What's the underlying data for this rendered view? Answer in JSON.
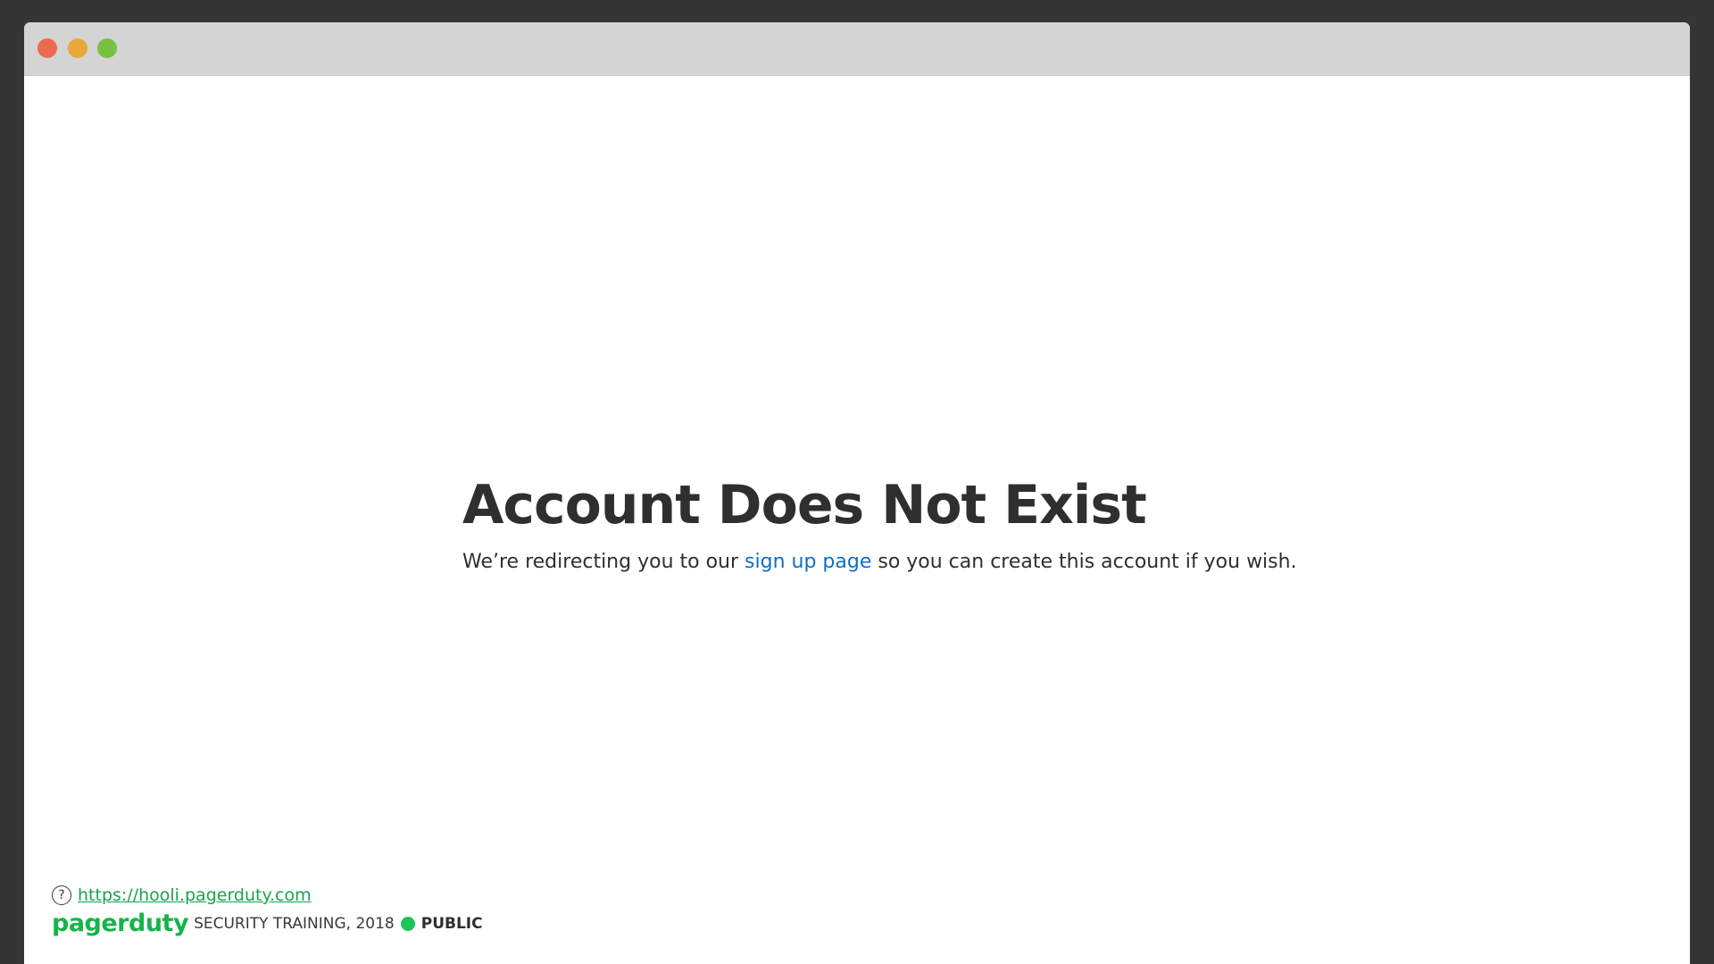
{
  "window": {
    "buttons": [
      "close",
      "minimize",
      "zoom"
    ]
  },
  "main": {
    "title": "Account Does Not Exist",
    "message_before": "We’re redirecting you to our ",
    "link_label": "sign up page",
    "message_after": " so you can create this account if you wish.",
    "link_color": "#0e6fc6"
  },
  "footer": {
    "icon": "help-circle-icon",
    "url": "https://hooli.pagerduty.com",
    "brand": "pagerduty",
    "meta": "SECURITY TRAINING, 2018",
    "classification": "PUBLIC",
    "accent": "#1fc45a"
  }
}
